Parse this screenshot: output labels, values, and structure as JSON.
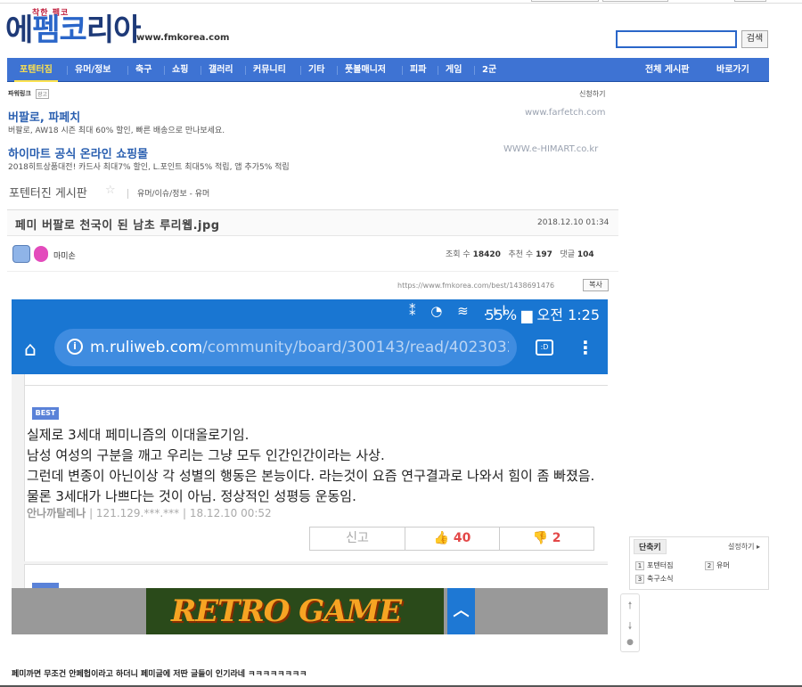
{
  "logo": {
    "tagline": "착한 펨코",
    "main": "에펨코리아",
    "url": "www.fmkorea.com"
  },
  "search": {
    "value": "",
    "button": "검색"
  },
  "nav": {
    "items": [
      {
        "label": "포텐터짐",
        "active": true
      },
      {
        "label": "유머/정보"
      },
      {
        "label": "축구"
      },
      {
        "label": "쇼핑"
      },
      {
        "label": "갤러리"
      },
      {
        "label": "커뮤니티"
      },
      {
        "label": "기타"
      },
      {
        "label": "풋볼매니저"
      },
      {
        "label": "피파"
      },
      {
        "label": "게임"
      },
      {
        "label": "2군"
      }
    ],
    "all_boards": "전체 게시판",
    "shortcuts": "바로가기"
  },
  "powerlink": {
    "label": "파워링크",
    "ad_badge": "광고",
    "apply": "신청하기",
    "ads": [
      {
        "title": "버팔로, 파페치",
        "desc": "버팔로, AW18 시즌 최대 60% 할인, 빠른 배송으로 만나보세요.",
        "url": "www.farfetch.com"
      },
      {
        "title": "하이마트 공식 온라인 쇼핑몰",
        "desc": "2018히트상품대전! 카드사 최대7% 할인, L.포인트 최대5% 적립, 앱 추가5% 적립",
        "url": "WWW.e-HIMART.co.kr"
      }
    ]
  },
  "board": {
    "name": "포텐터진 게시판",
    "star": "☆",
    "category": "유머/이슈/정보 - 유머"
  },
  "post": {
    "title": "페미 버팔로 천국이 된 남초 루리웹.jpg",
    "date": "2018.12.10 01:34",
    "author": "마미손",
    "views_label": "조회 수",
    "views": "18420",
    "likes_label": "추천 수",
    "likes": "197",
    "comments_label": "댓글",
    "comments": "104",
    "url": "https://www.fmkorea.com/best/1438691476",
    "copy": "복사"
  },
  "shot": {
    "status": "55% ▆ 오전 1:25",
    "status_icons": "⁑ ◔ ≋ .ıl",
    "url_domain": "m.ruliweb.com",
    "url_path": "/community/board/300143/read/40230326?vie",
    "tab_label": ":D",
    "best": "BEST",
    "lines": [
      "실제로 3세대 페미니즘의 이대올로기임.",
      "남성 여성의 구분을 깨고 우리는 그냥 모두 인간인간이라는 사상.",
      "그런데 변종이 아닌이상 각 성별의 행동은 본능이다. 라는것이 요즘 연구결과로 나와서 힘이 좀 빠졌음.",
      "물론 3세대가 나쁘다는 것이 아님. 정상적인 성평등 운동임."
    ],
    "meta_name": "안나까탈레나",
    "meta_rest": " | 121.129.***.*** | 18.12.10 00:52",
    "report": "신고",
    "like": "40",
    "dislike": "2",
    "banner": "RETRO GAME"
  },
  "shortcut_box": {
    "title": "단축키",
    "setting": "설정하기 ▸",
    "items": [
      {
        "num": "1",
        "label": "포텐터짐"
      },
      {
        "num": "2",
        "label": "유머"
      },
      {
        "num": "3",
        "label": "축구소식"
      }
    ]
  },
  "float": {
    "up": "🠕",
    "down": "🠗",
    "chat": "●"
  },
  "bottom": {
    "text": "페미까면 무조건 안페헙이라고 하더니 페미글에 저딴 글들이 인기라네 ㅋㅋㅋㅋㅋㅋㅋㅋ"
  }
}
